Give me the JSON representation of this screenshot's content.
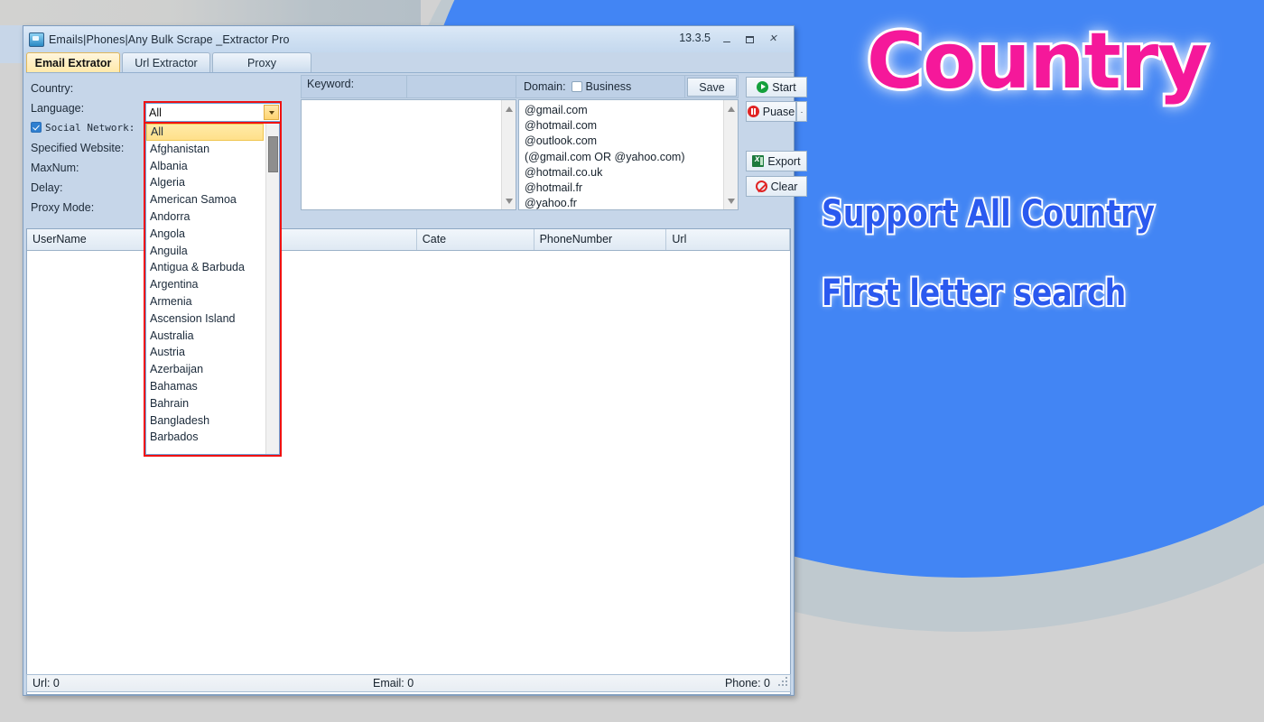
{
  "window": {
    "title": "Emails|Phones|Any Bulk Scrape _Extractor Pro",
    "version": "13.3.5",
    "minimize_label": "–",
    "maximize_label": "□",
    "close_label": "✕"
  },
  "tabs": [
    {
      "label": "Email Extrator",
      "active": true
    },
    {
      "label": "Url Extractor",
      "active": false
    },
    {
      "label": "Proxy",
      "active": false
    }
  ],
  "form": {
    "labels": [
      "Country:",
      "Language:",
      "Social Network:",
      "Specified Website:",
      "MaxNum:",
      "Delay:",
      "Proxy Mode:"
    ],
    "social_network_checked": true,
    "country_value": "All",
    "keyword_label": "Keyword:",
    "keyword_value": "",
    "domain_label": "Domain:",
    "business_label": "Business",
    "business_checked": false,
    "save_label": "Save"
  },
  "country_options": [
    "All",
    "Afghanistan",
    "Albania",
    "Algeria",
    "American Samoa",
    "Andorra",
    "Angola",
    "Anguila",
    "Antigua & Barbuda",
    "Argentina",
    "Armenia",
    "Ascension Island",
    "Australia",
    "Austria",
    "Azerbaijan",
    "Bahamas",
    "Bahrain",
    "Bangladesh",
    "Barbados"
  ],
  "domain_list": [
    "@gmail.com",
    "@hotmail.com",
    "@outlook.com",
    "(@gmail.com OR @yahoo.com)",
    "@hotmail.co.uk",
    "@hotmail.fr",
    "@yahoo.fr"
  ],
  "actions": {
    "start": "Start",
    "pause": "Puase",
    "pause_dropdown": "·",
    "export": "Export",
    "clear": "Clear"
  },
  "grid": {
    "columns": [
      "UserName",
      "",
      "Cate",
      "PhoneNumber",
      "Url"
    ],
    "rows": []
  },
  "status": {
    "url": "Url:  0",
    "email": "Email:  0",
    "phone": "Phone:  0"
  },
  "promo": {
    "title": "Country",
    "line1": "Support All Country",
    "line2": "First letter search"
  },
  "colors": {
    "accent_blue": "#4285f4",
    "promo_pink": "#f5189a",
    "promo_blue": "#2a59ef",
    "highlight_red": "#f01111",
    "window_chrome": "#c6d6e9"
  }
}
